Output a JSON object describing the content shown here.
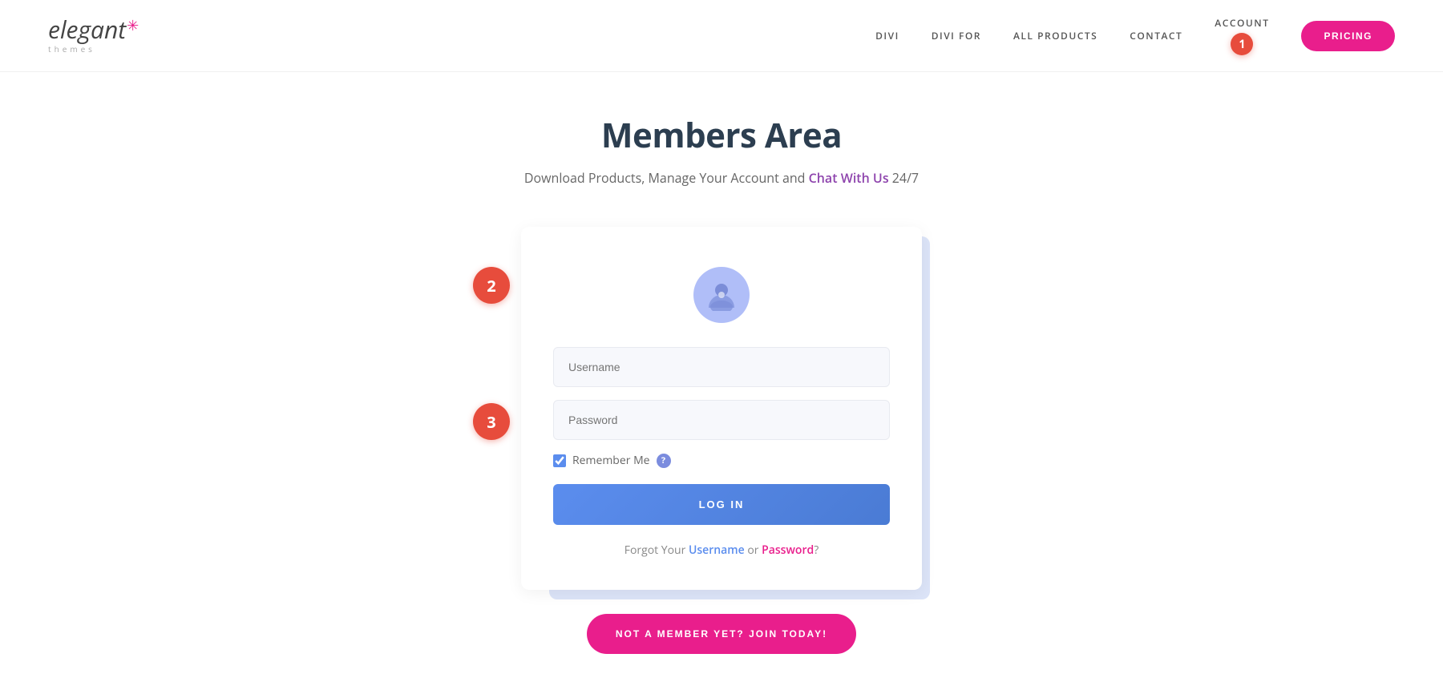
{
  "header": {
    "logo": {
      "elegant": "elegant",
      "star": "✳",
      "themes": "themes"
    },
    "nav": {
      "divi": "DIVI",
      "divi_for": "DIVI FOR",
      "all_products": "ALL PRODUCTS",
      "contact": "CONTACT",
      "account": "ACCOUNT",
      "account_badge": "1",
      "pricing": "PRICING"
    }
  },
  "main": {
    "title": "Members Area",
    "subtitle_text": "Download Products, Manage Your Account and ",
    "subtitle_link": "Chat With Us",
    "subtitle_suffix": " 24/7"
  },
  "form": {
    "username_placeholder": "Username",
    "password_placeholder": "Password",
    "remember_me": "Remember Me",
    "login_button": "LOG IN",
    "forgot_text": "Forgot Your ",
    "forgot_username": "Username",
    "forgot_or": " or ",
    "forgot_password": "Password",
    "forgot_suffix": "?"
  },
  "annotations": {
    "a1": "1",
    "a2": "2",
    "a3": "3"
  },
  "join": {
    "label": "NOT A MEMBER YET? JOIN TODAY!"
  },
  "help_icon": "?"
}
